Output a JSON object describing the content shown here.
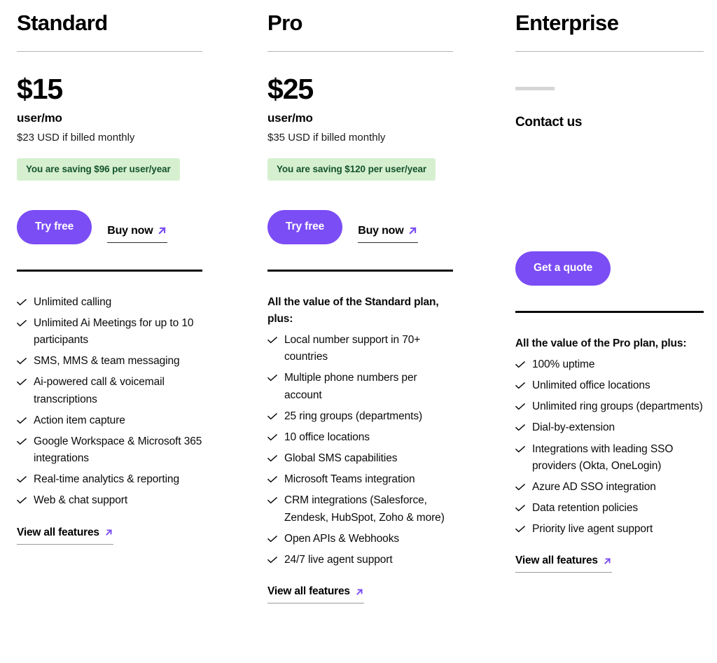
{
  "accent_color": "#7B4DF5",
  "badge_bg_color": "#D6F0CF",
  "badge_text_color": "#14532D",
  "icons": {
    "check": "check-icon",
    "arrow_up_right": "arrow-up-right-icon"
  },
  "plans": [
    {
      "id": "standard",
      "title": "Standard",
      "price": "$15",
      "price_unit": "user/mo",
      "price_note": "$23 USD if billed monthly",
      "savings": "You are saving $96 per user/year",
      "primary_cta": "Try free",
      "secondary_cta": "Buy now",
      "features_lead": "",
      "features": [
        "Unlimited calling",
        "Unlimited Ai Meetings for up to 10 participants",
        "SMS, MMS & team messaging",
        "Ai-powered call & voicemail transcriptions",
        "Action item capture",
        "Google Workspace & Microsoft 365 integrations",
        "Real-time analytics & reporting",
        "Web & chat support"
      ],
      "view_all": "View all features"
    },
    {
      "id": "pro",
      "title": "Pro",
      "price": "$25",
      "price_unit": "user/mo",
      "price_note": "$35 USD if billed monthly",
      "savings": "You are saving $120 per user/year",
      "primary_cta": "Try free",
      "secondary_cta": "Buy now",
      "features_lead": "All the value of the Standard plan, plus:",
      "features": [
        "Local number support in 70+ countries",
        "Multiple phone numbers per account",
        "25 ring groups (departments)",
        "10 office locations",
        "Global SMS capabilities",
        "Microsoft Teams integration",
        "CRM integrations (Salesforce, Zendesk, HubSpot, Zoho & more)",
        "Open APIs & Webhooks",
        "24/7 live agent support"
      ],
      "view_all": "View all features"
    },
    {
      "id": "enterprise",
      "title": "Enterprise",
      "price": "",
      "price_unit": "",
      "price_note": "",
      "savings": "",
      "contact_label": "Contact us",
      "primary_cta": "Get a quote",
      "secondary_cta": "",
      "features_lead": "All the value of the Pro plan, plus:",
      "features": [
        "100% uptime",
        "Unlimited office locations",
        "Unlimited ring groups (departments)",
        "Dial-by-extension",
        "Integrations with leading SSO providers (Okta, OneLogin)",
        "Azure AD SSO integration",
        "Data retention policies",
        "Priority live agent support"
      ],
      "view_all": "View all features"
    }
  ]
}
